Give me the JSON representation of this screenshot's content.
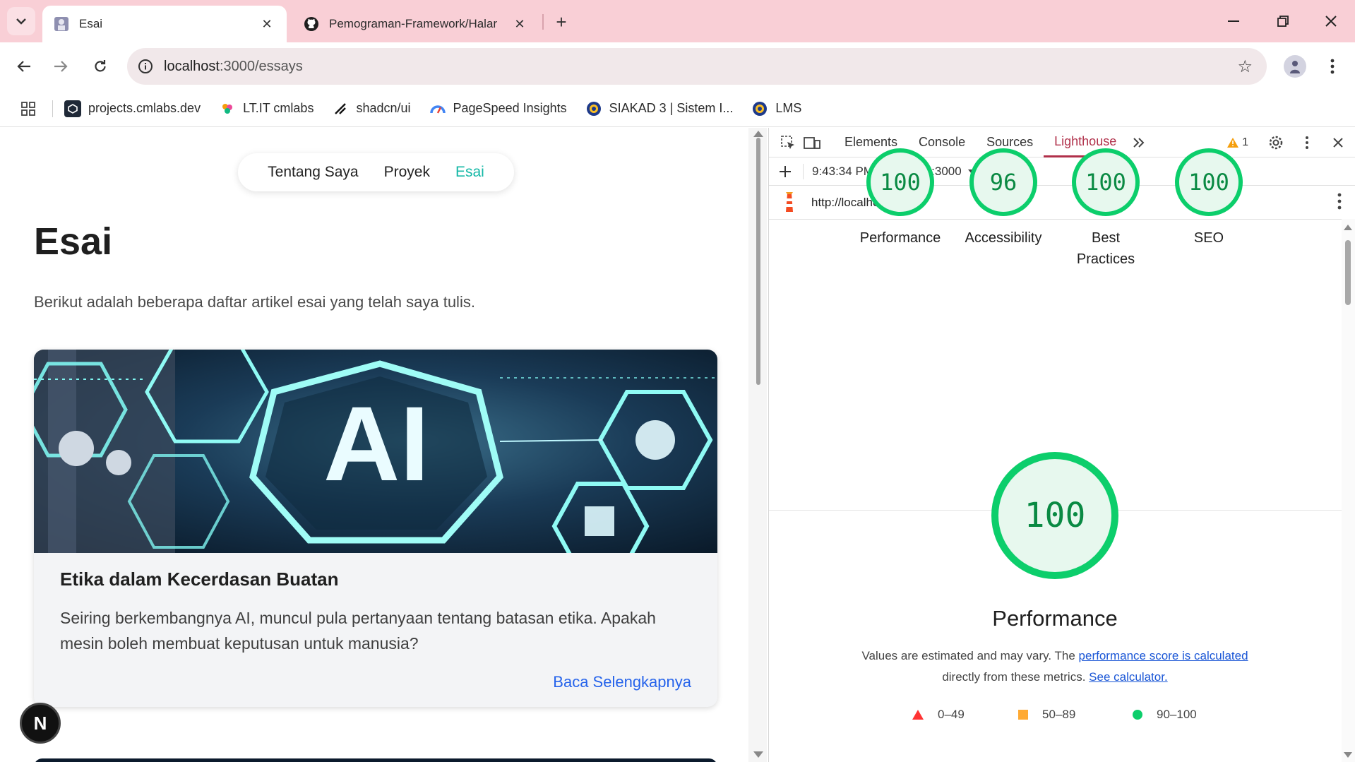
{
  "browser": {
    "tabs": [
      {
        "title": "Esai",
        "active": true
      },
      {
        "title": "Pemograman-Framework/Halar",
        "active": false
      }
    ],
    "url_host": "localhost",
    "url_rest": ":3000/essays",
    "bookmarks": [
      {
        "label": "projects.cmlabs.dev",
        "icon": "cmlabs-icon"
      },
      {
        "label": "LT.IT cmlabs",
        "icon": "lt-it-icon"
      },
      {
        "label": "shadcn/ui",
        "icon": "shadcn-icon"
      },
      {
        "label": "PageSpeed Insights",
        "icon": "pagespeed-icon"
      },
      {
        "label": "SIAKAD 3 | Sistem I...",
        "icon": "siakad-icon"
      },
      {
        "label": "LMS",
        "icon": "lms-icon"
      }
    ]
  },
  "site": {
    "nav": {
      "about": "Tentang Saya",
      "projects": "Proyek",
      "essays": "Esai"
    },
    "title": "Esai",
    "subtitle": "Berikut adalah beberapa daftar artikel esai yang telah saya tulis.",
    "card": {
      "image_text": "AI",
      "title": "Etika dalam Kecerdasan Buatan",
      "description": "Seiring berkembangnya AI, muncul pula pertanyaan tentang batasan etika. Apakah mesin boleh membuat keputusan untuk manusia?",
      "link": "Baca Selengkapnya"
    },
    "badge": "N"
  },
  "devtools": {
    "tabs": [
      "Elements",
      "Console",
      "Sources",
      "Lighthouse"
    ],
    "active_tab": "Lighthouse",
    "warning_count": "1",
    "report_time": "9:43:34 PM - localhost:3000",
    "report_url": "http://localhost:3000/",
    "scores": [
      {
        "value": "100",
        "label": "Performance"
      },
      {
        "value": "96",
        "label": "Accessibility"
      },
      {
        "value": "100",
        "label": "Best Practices"
      },
      {
        "value": "100",
        "label": "SEO"
      }
    ],
    "main_score": "100",
    "main_title": "Performance",
    "note_1": "Values are estimated and may vary. The ",
    "note_link_1": "performance score is calculated",
    "note_2": "directly from these metrics. ",
    "note_link_2": "See calculator.",
    "legend": [
      "0–49",
      "50–89",
      "90–100"
    ],
    "colors": {
      "pass": "#0cce6b",
      "average": "#ffaa33",
      "fail": "#ff3333",
      "accent": "#14b8a6"
    }
  }
}
